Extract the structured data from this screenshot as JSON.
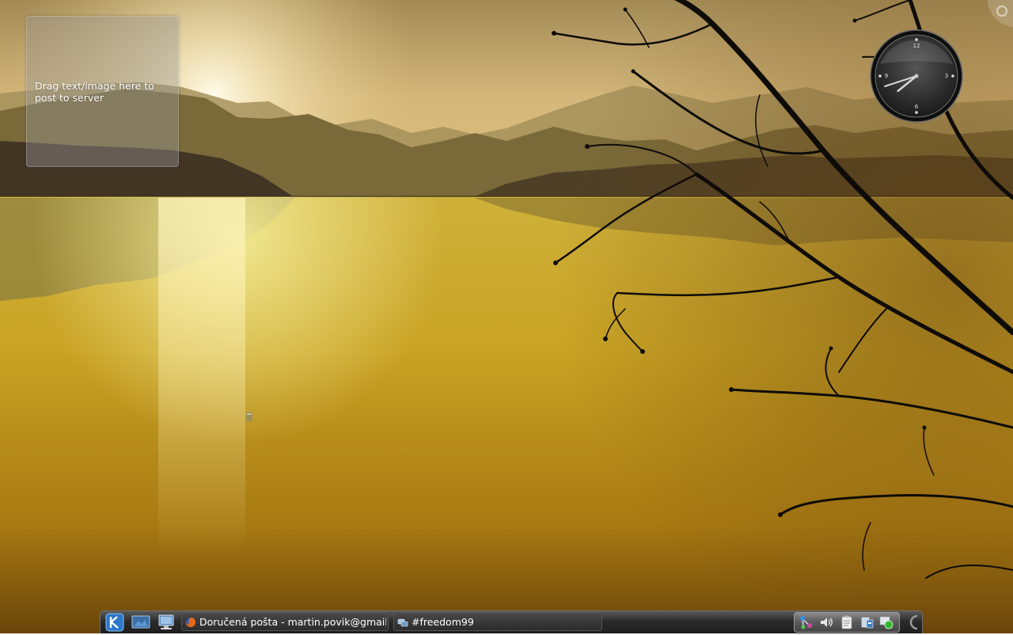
{
  "desktop": {
    "pastebin": {
      "text": "Drag text/image here to post to server"
    }
  },
  "clock": {
    "numerals": [
      "12",
      "3",
      "6",
      "9"
    ],
    "time": {
      "hour": 7,
      "minute": 42
    }
  },
  "taskbar": {
    "launchers": [
      {
        "icon": "kde-menu-icon"
      },
      {
        "icon": "show-desktop-icon"
      },
      {
        "icon": "system-settings-icon"
      }
    ],
    "tasks": [
      {
        "label": "Doručená pošta - martin.povik@gmail",
        "icon": "firefox-icon"
      },
      {
        "label": "#freedom99",
        "icon": "chat-icon"
      }
    ],
    "tray": [
      {
        "icon": "network-icon"
      },
      {
        "icon": "volume-icon"
      },
      {
        "icon": "clipboard-icon"
      },
      {
        "icon": "package-manager-icon"
      },
      {
        "icon": "update-notifier-icon"
      }
    ]
  },
  "colors": {
    "sky_top": "#b79a52",
    "lake": "#c8a42a",
    "panel": "#2b2b2b"
  }
}
